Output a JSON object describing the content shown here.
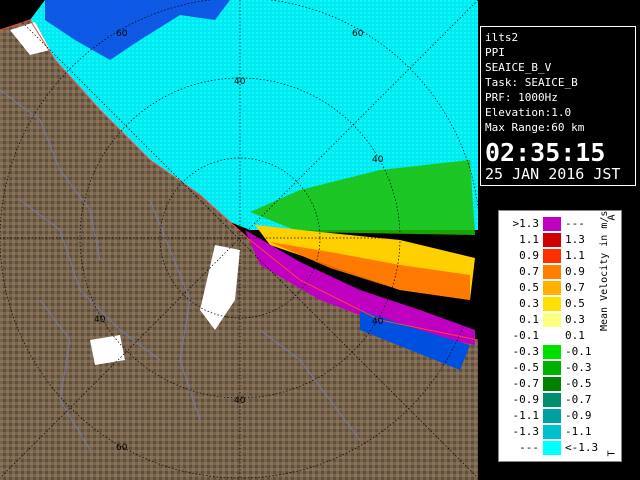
{
  "info": {
    "lines": [
      "ilts2",
      "PPI",
      "SEAICE_B_V",
      "Task: SEAICE_B",
      "PRF: 1000Hz",
      "Elevation:1.0",
      "Max Range:60 km"
    ],
    "time": "02:35:15",
    "date": "25 JAN 2016 JST"
  },
  "legend": {
    "title": "Mean Velocity in m/s",
    "end_top": "A",
    "end_bottom": "T",
    "rows": [
      {
        "lo": ">1.3",
        "hi": "---",
        "color": "#c000c0"
      },
      {
        "lo": "1.1",
        "hi": "1.3",
        "color": "#d00000"
      },
      {
        "lo": "0.9",
        "hi": "1.1",
        "color": "#ff3000"
      },
      {
        "lo": "0.7",
        "hi": "0.9",
        "color": "#ff8000"
      },
      {
        "lo": "0.5",
        "hi": "0.7",
        "color": "#ffb000"
      },
      {
        "lo": "0.3",
        "hi": "0.5",
        "color": "#ffe000"
      },
      {
        "lo": "0.1",
        "hi": "0.3",
        "color": "#ffff80"
      },
      {
        "lo": "-0.1",
        "hi": "0.1",
        "color": "#ffffff"
      },
      {
        "lo": "-0.3",
        "hi": "-0.1",
        "color": "#00e000"
      },
      {
        "lo": "-0.5",
        "hi": "-0.3",
        "color": "#00b000"
      },
      {
        "lo": "-0.7",
        "hi": "-0.5",
        "color": "#008000"
      },
      {
        "lo": "-0.9",
        "hi": "-0.7",
        "color": "#009070"
      },
      {
        "lo": "-1.1",
        "hi": "-0.9",
        "color": "#00a0a0"
      },
      {
        "lo": "-1.3",
        "hi": "-1.1",
        "color": "#00c0d0"
      },
      {
        "lo": "---",
        "hi": "<-1.3",
        "color": "#00ffff"
      }
    ]
  },
  "ring_labels": {
    "north": [
      "60",
      "40"
    ],
    "east": [
      "40",
      "40"
    ],
    "west": [
      "40"
    ],
    "south": [
      "40",
      "60"
    ]
  },
  "colors": {
    "land": "#7a6650",
    "sea_ice": "#00f0f0",
    "approach": "#c000c0",
    "recede": "#00e0ff"
  }
}
